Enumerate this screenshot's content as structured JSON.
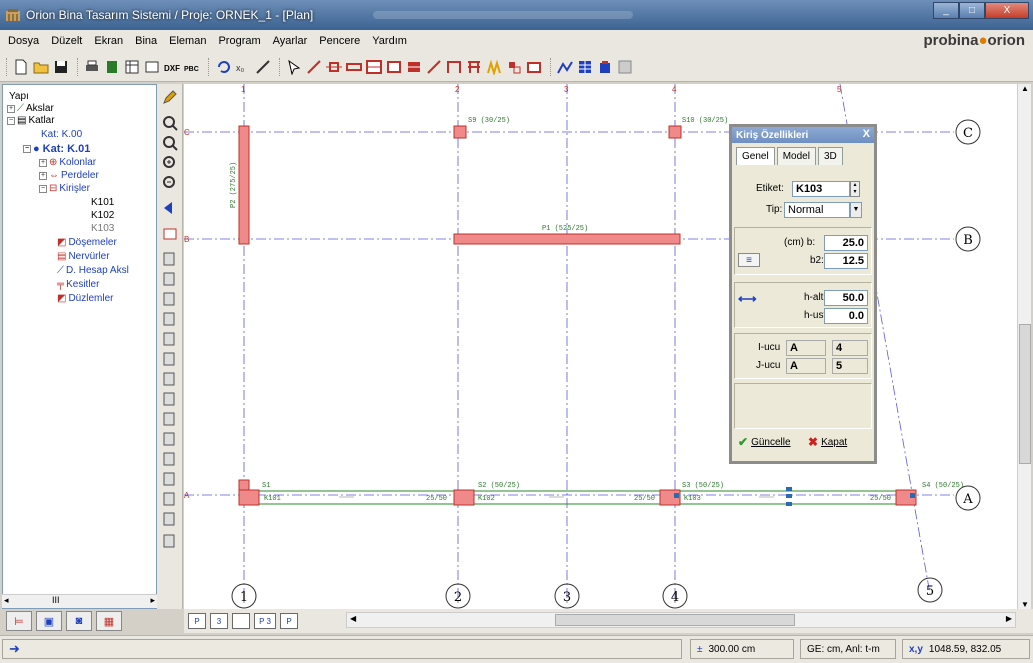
{
  "window": {
    "title": "Orion Bina Tasarım Sistemi / Proje: ORNEK_1 - [Plan]",
    "controls": [
      "_",
      "□",
      "X"
    ]
  },
  "menu": {
    "items": [
      "Dosya",
      "Düzelt",
      "Ekran",
      "Bina",
      "Eleman",
      "Program",
      "Ayarlar",
      "Pencere",
      "Yardım"
    ],
    "logo_left": "probina",
    "logo_right": "orion"
  },
  "tree": {
    "nodes": [
      {
        "label": "Yapı"
      },
      {
        "label": "Akslar"
      },
      {
        "label": "Katlar"
      },
      {
        "label": "Kat: K.00"
      },
      {
        "label": "Kat: K.01"
      },
      {
        "label": "Kolonlar"
      },
      {
        "label": "Perdeler"
      },
      {
        "label": "Kirişler"
      },
      {
        "label": "K101"
      },
      {
        "label": "K102"
      },
      {
        "label": "K103"
      },
      {
        "label": "Döşemeler"
      },
      {
        "label": "Nervürler"
      },
      {
        "label": "D. Hesap Aksl"
      },
      {
        "label": "Kesitler"
      },
      {
        "label": "Düzlemler"
      }
    ],
    "scroll_label": "III"
  },
  "plan": {
    "axes_x": [
      "1",
      "2",
      "3",
      "4",
      "5"
    ],
    "axes_y": [
      "C",
      "B",
      "A"
    ],
    "labels": {
      "c_axis": "C",
      "b_axis": "B",
      "a_axis": "A",
      "s9": "S9 (30/25)",
      "s10": "S10 (30/25)",
      "p2": "P2 (275/25)",
      "p1": "P1 (525/25)",
      "s1": "S1",
      "s2": "S2 (50/25)",
      "s3": "S3 (50/25)",
      "s4": "S4 (50/25)",
      "k101": "K101",
      "k102": "K102",
      "k103": "K103",
      "sz1": "25/50",
      "sz2": "25/50",
      "sz3": "25/50"
    }
  },
  "panel": {
    "title": "Kiriş Özellikleri",
    "close": "X",
    "tabs": [
      "Genel",
      "Model",
      "3D"
    ],
    "etiket_label": "Etiket:",
    "etiket_value": "K103",
    "tip_label": "Tip:",
    "tip_value": "Normal",
    "b_label": "(cm) b:",
    "b_value": "25.0",
    "b2_label": "b2:",
    "b2_value": "12.5",
    "halt_label": "h-alt:",
    "halt_value": "50.0",
    "hust_label": "h-ust:",
    "hust_value": "0.0",
    "iucu_label": "I-ucu",
    "iucu_axis": "A",
    "iucu_num": "4",
    "jucu_label": "J-ucu",
    "jucu_axis": "A",
    "jucu_num": "5",
    "update_label": "Güncelle",
    "close_label": "Kapat"
  },
  "status": {
    "elevation": "300.00 cm",
    "units": "GE: cm,  Anl: t-m",
    "coord_label": "x,y",
    "coord_value": "1048.59, 832.05"
  },
  "bottom_tabs": [
    "P",
    "3",
    "",
    "P 3",
    "P"
  ]
}
